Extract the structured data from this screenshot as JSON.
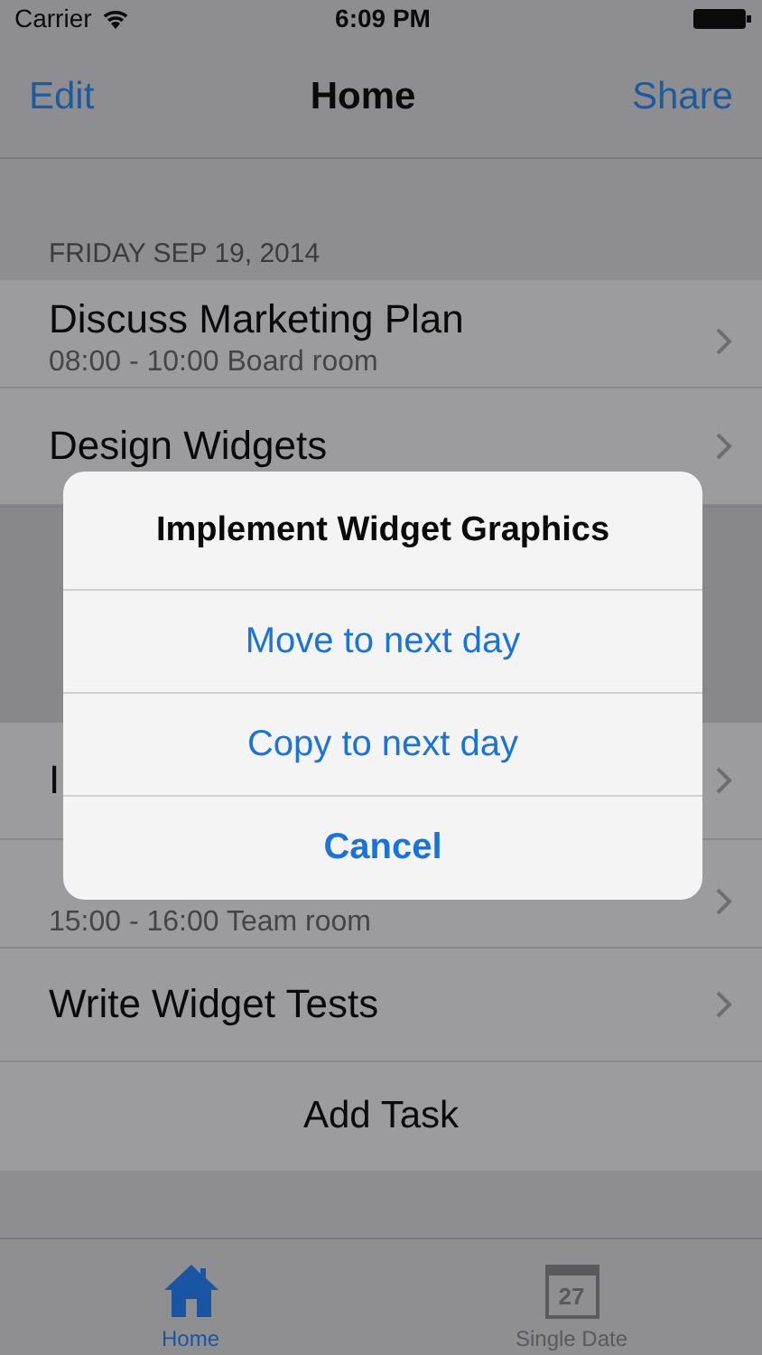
{
  "status_bar": {
    "carrier": "Carrier",
    "time": "6:09 PM"
  },
  "nav": {
    "left": "Edit",
    "title": "Home",
    "right": "Share"
  },
  "sections": [
    {
      "header": "FRIDAY SEP 19, 2014",
      "rows": [
        {
          "title": "Discuss Marketing Plan",
          "subtitle": "08:00 - 10:00 Board room"
        },
        {
          "title": "Design Widgets"
        }
      ]
    },
    {
      "rows": [
        {
          "title": "I"
        },
        {
          "subtitle": "15:00 - 16:00 Team room"
        },
        {
          "title": "Write Widget Tests"
        }
      ]
    }
  ],
  "add_task": "Add Task",
  "tabs": [
    {
      "label": "Home",
      "kind": "home",
      "selected": true
    },
    {
      "label": "Single Date",
      "kind": "calendar",
      "icon_text": "27",
      "selected": false
    }
  ],
  "alert": {
    "title": "Implement Widget Graphics",
    "actions": [
      {
        "label": "Move to next day",
        "kind": "default"
      },
      {
        "label": "Copy to next day",
        "kind": "default"
      },
      {
        "label": "Cancel",
        "kind": "cancel"
      }
    ]
  }
}
